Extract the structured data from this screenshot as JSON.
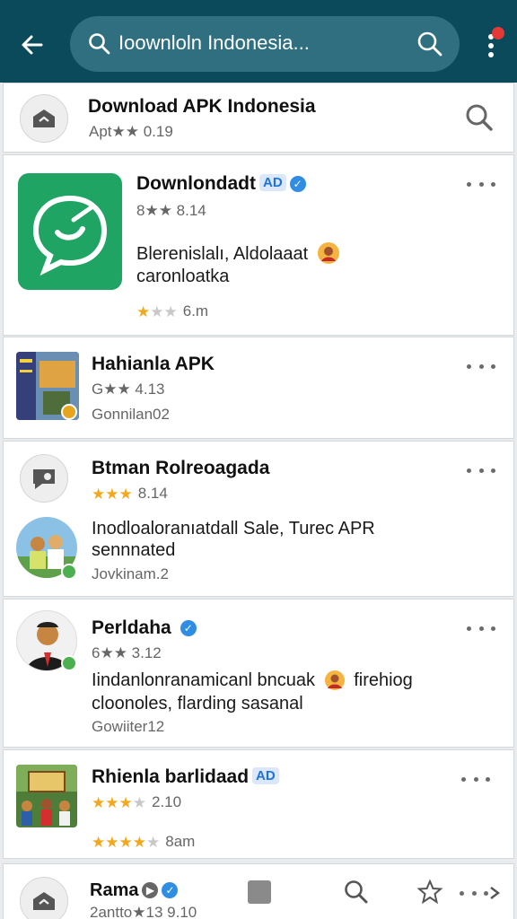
{
  "topbar": {
    "search_text": "Ioownloln Indonesia..."
  },
  "header_card": {
    "title": "Download APK Indonesia",
    "meta": "Apt★★ 0.19"
  },
  "items": [
    {
      "title": "Downlondadt",
      "badge": "AD",
      "meta": "8★★ 8.14",
      "desc_line1": "Blerenislalı, Aldolaaat",
      "desc_line2": "caronloatka",
      "size": "6.m",
      "rating": 1
    },
    {
      "title": "Hahianla APK",
      "meta": "G★★ 4.13",
      "sub": "Gonnilan02",
      "rating": 2
    },
    {
      "title": "Btman Rolreoagada",
      "meta": "8.14",
      "desc_line1": "Inodloaloranıatdall Sale, Turec APR",
      "desc_line2": "sennnated",
      "sub": "Jovkinam.2",
      "rating": 3
    },
    {
      "title": "Perldaha",
      "meta": "6★★ 3.12",
      "desc_line1": "Iindanlonranamicanl bncuak",
      "desc_line1b": "firehiog",
      "desc_line2": "cloonoles, flarding sasanal",
      "sub": "Gowiiter12",
      "rating": 2
    },
    {
      "title": "Rhienla barlidaad",
      "badge": "AD",
      "meta": "2.10",
      "size": "8am",
      "rating": 4
    }
  ],
  "bottom_card": {
    "title": "Rama",
    "meta": "2antto★13 9.10"
  },
  "colors": {
    "appbar": "#0b4a5a",
    "search": "#2f6f7f",
    "accent_green": "#1fa463",
    "star": "#f2a81d",
    "verified": "#2f8de4",
    "notif": "#e53935"
  }
}
